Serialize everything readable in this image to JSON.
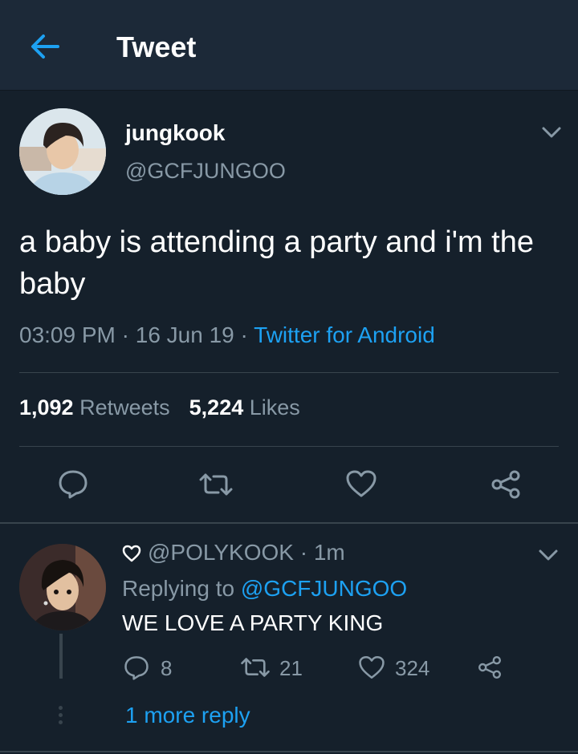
{
  "header": {
    "title": "Tweet",
    "back_icon": "arrow-left-icon"
  },
  "tweet": {
    "author_name": "jungkook",
    "author_handle": "@GCFJUNGOO",
    "text": "a baby is attending a party and i'm the baby",
    "time": "03:09 PM",
    "date": "16 Jun 19",
    "separator": " · ",
    "source": "Twitter for Android",
    "retweets": "1,092",
    "retweets_label": "Retweets",
    "likes": "5,224",
    "likes_label": "Likes"
  },
  "reply": {
    "handle": "@POLYKOOK",
    "time": "· 1m",
    "replying_label": "Replying to",
    "replying_to": "@GCFJUNGOO",
    "text": "WE LOVE A PARTY KING",
    "reply_count": "8",
    "retweet_count": "21",
    "like_count": "324",
    "more_replies": "1 more reply"
  },
  "colors": {
    "background": "#15202b",
    "header_background": "#1c2938",
    "accent": "#1da1f2",
    "secondary_text": "#8899a6",
    "divider": "#38444d"
  }
}
